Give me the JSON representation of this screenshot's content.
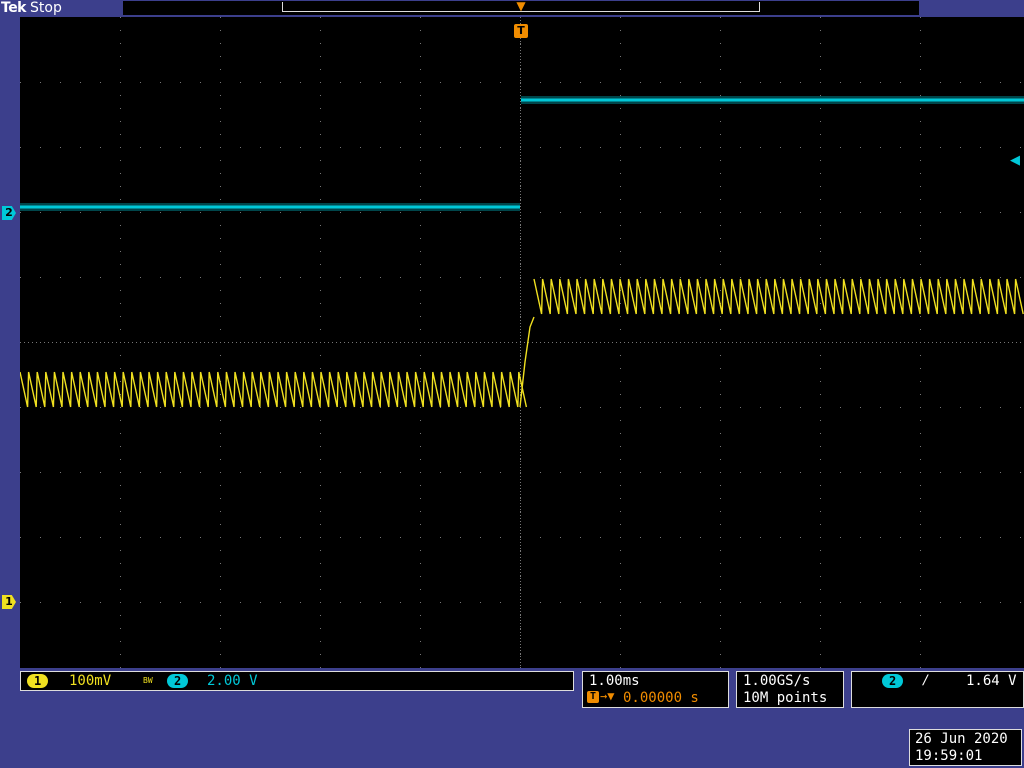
{
  "header": {
    "brand": "Tek",
    "acq_state": "Stop"
  },
  "trigger": {
    "marker_label": "T",
    "position_arrow": "trigger-position-arrow",
    "level_arrow": "trigger-level-arrow",
    "source_channel": "2",
    "slope_symbol": "╨",
    "slope_icon": "rising-edge-icon",
    "level": "1.64 V",
    "delay": "0.00000 s",
    "delay_prefix": "→▼"
  },
  "channels": [
    {
      "id": "1",
      "scale": "100mV",
      "bw_limit": "BW",
      "color": "#f0e020"
    },
    {
      "id": "2",
      "scale": "2.00 V",
      "color": "#00c8d8"
    }
  ],
  "horizontal": {
    "time_per_div": "1.00ms"
  },
  "acquisition": {
    "sample_rate": "1.00GS/s",
    "record_length": "10M points"
  },
  "datetime": {
    "date": "26 Jun 2020",
    "time": "19:59:01"
  },
  "colors": {
    "background": "#3c3f8c",
    "ch1": "#f0e020",
    "ch2": "#00c8d8",
    "trigger": "#f08c00"
  }
}
